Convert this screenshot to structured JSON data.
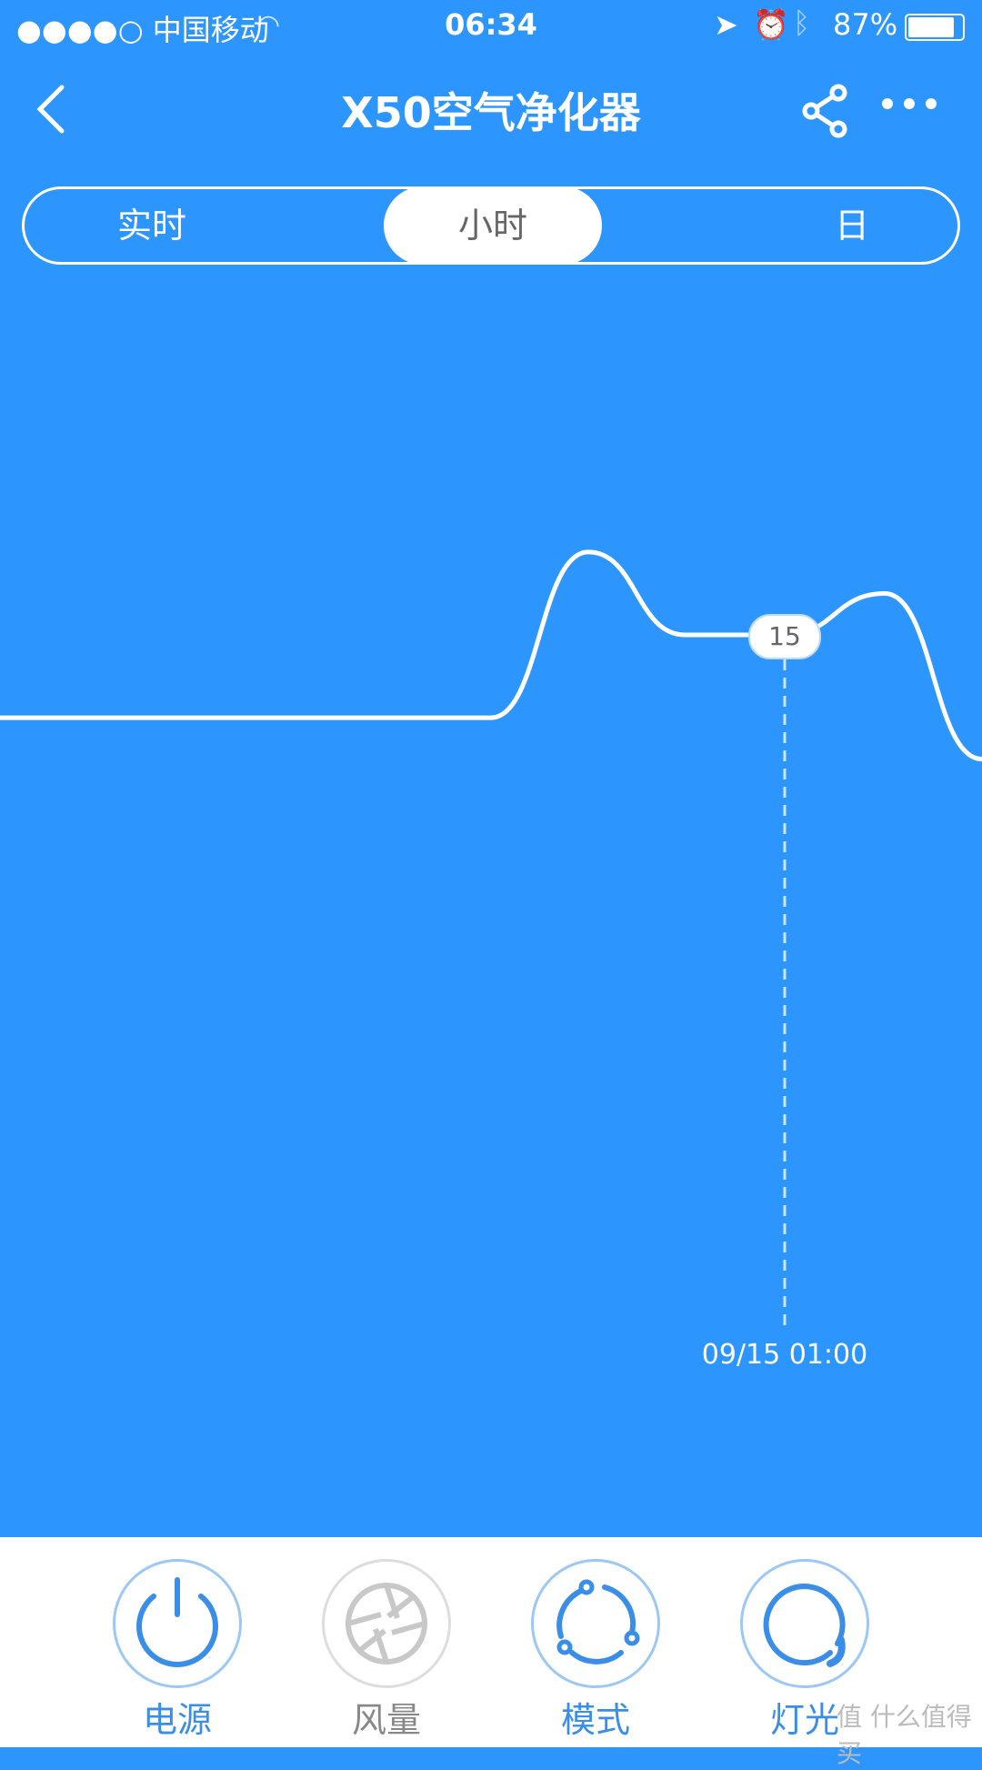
{
  "status_bar": {
    "carrier": "●●●●○ 中国移动",
    "time": "06:34",
    "battery": "87%",
    "icons": [
      "wifi-icon",
      "location-icon",
      "alarm-icon",
      "bluetooth-icon",
      "battery-icon"
    ]
  },
  "nav": {
    "title": "X50空气净化器",
    "back_icon": "chevron-left-icon",
    "share_icon": "share-icon",
    "more_icon": "more-icon"
  },
  "tabs": [
    {
      "label": "实时"
    },
    {
      "label": "小时",
      "active": true
    },
    {
      "label": "日"
    }
  ],
  "chart_data": {
    "type": "line",
    "series": [
      {
        "values": [
          13.2,
          13.2,
          16.8,
          15,
          15,
          15,
          15.9,
          12.3
        ]
      }
    ],
    "highlight": {
      "x": "09/15 01:00",
      "value": "15"
    },
    "colors": {
      "line": "#ffffff",
      "background": "#2d96fe"
    }
  },
  "controls": [
    {
      "label": "电源",
      "icon": "power-icon",
      "enabled": true
    },
    {
      "label": "风量",
      "icon": "fan-icon",
      "enabled": false
    },
    {
      "label": "模式",
      "icon": "mode-icon",
      "enabled": true
    },
    {
      "label": "灯光",
      "icon": "light-icon",
      "enabled": true
    }
  ],
  "colors": {
    "accent": "#2d96fe",
    "button_blue": "#3a8ee8"
  },
  "watermark": "值 什么值得买"
}
